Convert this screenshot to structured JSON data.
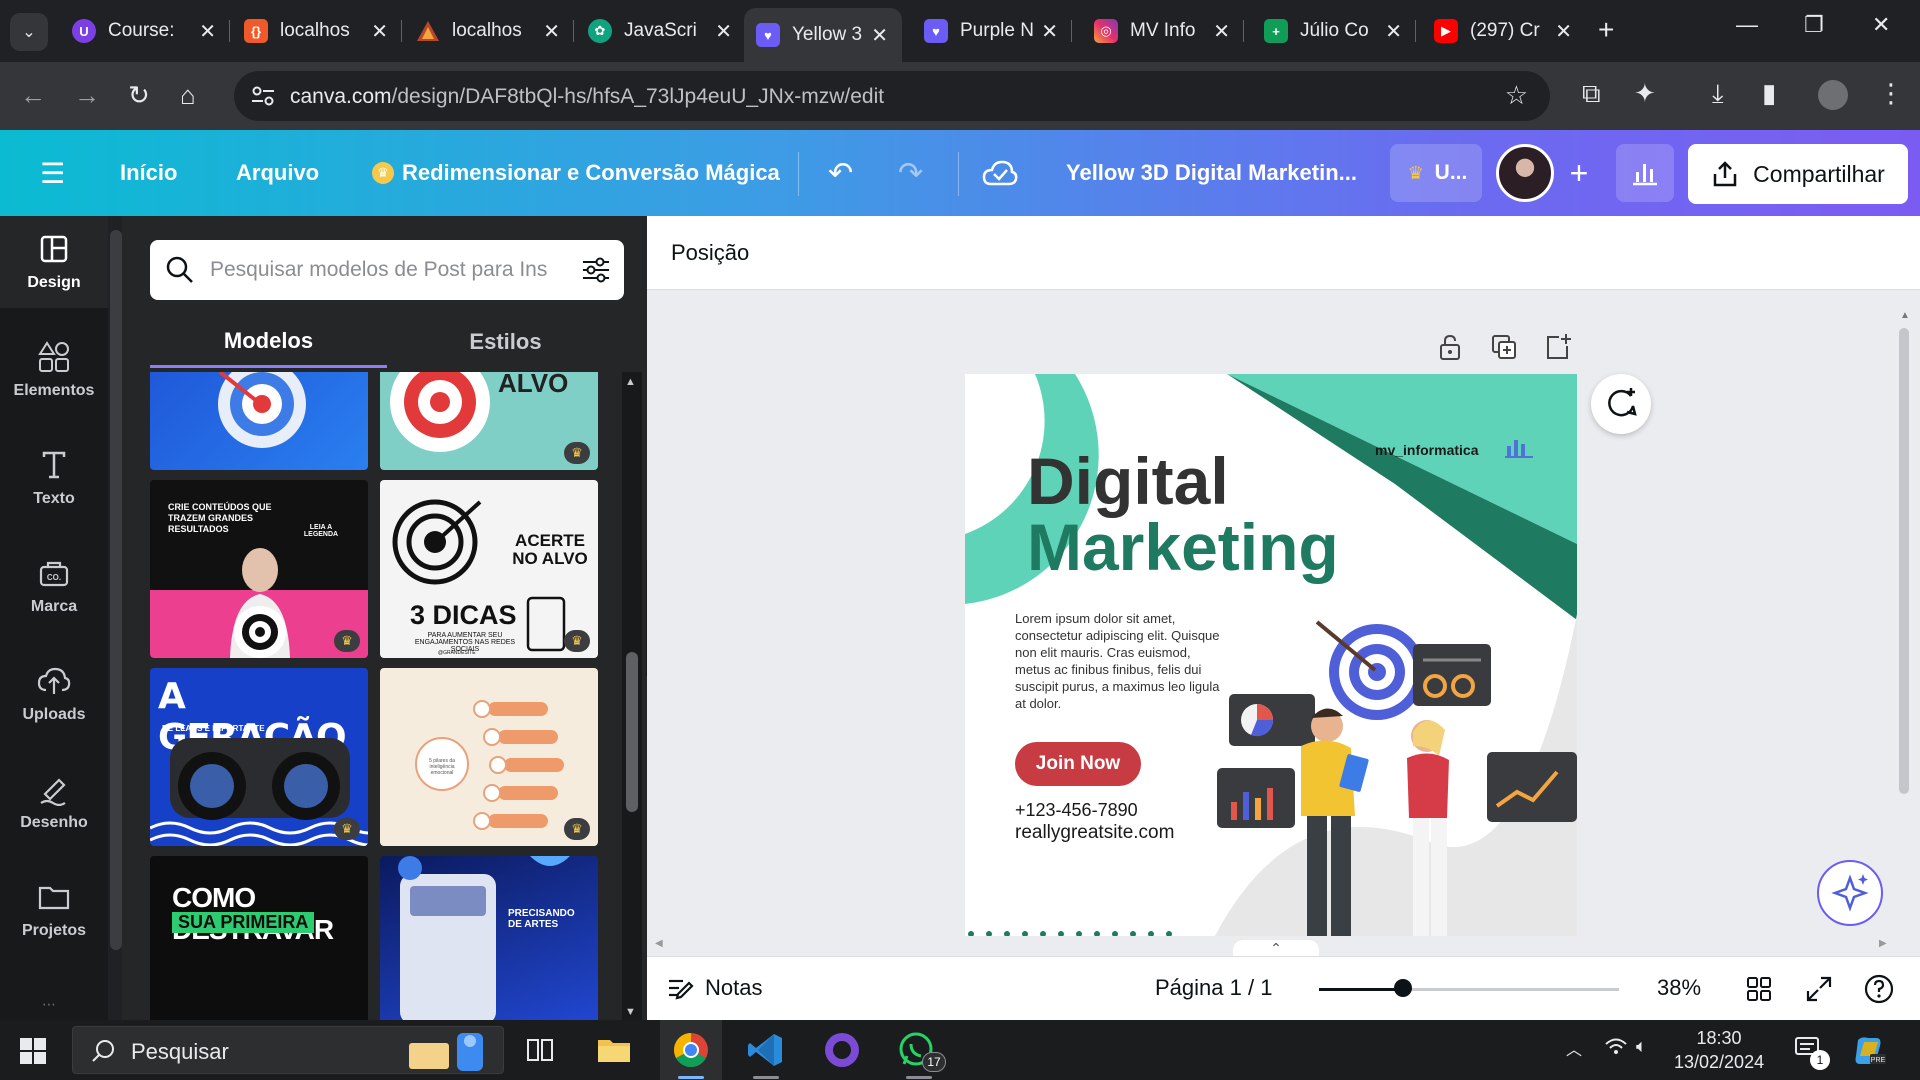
{
  "browser": {
    "tabs": [
      {
        "title": "Course:",
        "icon": "purple-circle-icon",
        "color": "#7b3fe4"
      },
      {
        "title": "localhos",
        "icon": "brackets-icon",
        "color": "#f05a28"
      },
      {
        "title": "localhos",
        "icon": "triangle-logo-icon",
        "color": "#b7472a"
      },
      {
        "title": "JavaScri",
        "icon": "openai-icon",
        "color": "#10a37f"
      },
      {
        "title": "Yellow 3",
        "icon": "heart-icon",
        "color": "#6b5cf6",
        "active": true
      },
      {
        "title": "Purple N",
        "icon": "heart-icon",
        "color": "#6b5cf6"
      },
      {
        "title": "MV Info",
        "icon": "instagram-icon",
        "color": "#e1306c"
      },
      {
        "title": "Júlio Co",
        "icon": "sheets-icon",
        "color": "#0f9d58"
      },
      {
        "title": "(297) Cr",
        "icon": "youtube-icon",
        "color": "#ff0000"
      }
    ],
    "url_host": "canva.com",
    "url_path": "/design/DAF8tbQl-hs/hfsA_73lJp4euU_JNx-mzw/edit"
  },
  "canva": {
    "menu": {
      "home": "Início",
      "file": "Arquivo",
      "magic": "Redimensionar e Conversão Mágica"
    },
    "doc_title": "Yellow 3D Digital Marketin...",
    "upgrade_label": "U...",
    "share_label": "Compartilhar",
    "rail": [
      {
        "label": "Design",
        "icon": "design-layout-icon"
      },
      {
        "label": "Elementos",
        "icon": "elements-shapes-icon"
      },
      {
        "label": "Texto",
        "icon": "text-t-icon"
      },
      {
        "label": "Marca",
        "icon": "brand-kit-icon"
      },
      {
        "label": "Uploads",
        "icon": "cloud-upload-icon"
      },
      {
        "label": "Desenho",
        "icon": "draw-pen-icon"
      },
      {
        "label": "Projetos",
        "icon": "folder-icon"
      }
    ],
    "search_placeholder": "Pesquisar modelos de Post para Ins",
    "panel_tabs": {
      "templates": "Modelos",
      "styles": "Estilos"
    },
    "templates": {
      "alvo_word": "ALVO",
      "crie_text": "CRIE CONTEÚDOS QUE TRAZEM GRANDES RESULTADOS",
      "leia_legenda": "LEIA A LEGENDA",
      "acerte": "ACERTE NO ALVO",
      "dicas": "3 DICAS",
      "dicas_sub": "PARA AUMENTAR SEU ENGAJAMENTOS NAS REDES SOCIAIS",
      "dicas_handle": "@GRANDESITE",
      "geracao": "A GERAÇÃO",
      "geracao_sub": "DE LEADS E IMPORTANTE",
      "pilares": "5 pilares da inteligência emocional",
      "destravar": "COMO DESTRAVAR",
      "destravar_sub": "SUA PRIMEIRA",
      "precisando": "PRECISANDO DE ARTES"
    },
    "position_label": "Posição",
    "design": {
      "handle": "mv_informatica",
      "title_line1": "Digital",
      "title_line2": "Marketing",
      "body": "Lorem ipsum dolor sit amet, consectetur adipiscing elit. Quisque non elit mauris. Cras euismod, metus ac finibus finibus, felis dui suscipit purus, a maximus leo ligula at dolor.",
      "cta": "Join Now",
      "phone": "+123-456-7890",
      "site": "reallygreatsite.com",
      "accent": "#5fd3b8",
      "dark_green": "#1f7a62",
      "cta_color": "#c73c42"
    },
    "notes_label": "Notas",
    "page_label": "Página 1 / 1",
    "zoom": "38%",
    "zoom_fraction": 0.28
  },
  "taskbar": {
    "search_placeholder": "Pesquisar",
    "whatsapp_badge": "17",
    "notif_badge": "1",
    "time": "18:30",
    "date": "13/02/2024"
  }
}
